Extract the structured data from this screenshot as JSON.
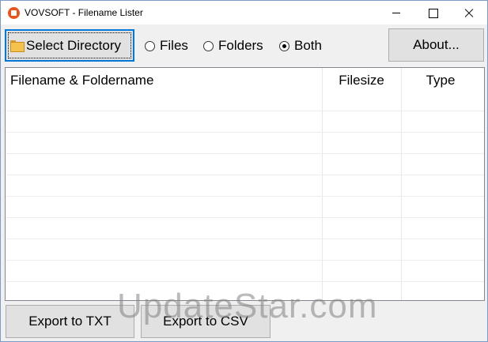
{
  "window": {
    "title": "VOVSOFT - Filename Lister"
  },
  "toolbar": {
    "select_directory_label": "Select Directory",
    "radio_files_label": "Files",
    "radio_folders_label": "Folders",
    "radio_both_label": "Both",
    "selected_mode": "Both",
    "about_label": "About..."
  },
  "list": {
    "columns": [
      "Filename & Foldername",
      "Filesize",
      "Type"
    ],
    "rows": []
  },
  "footer": {
    "export_txt_label": "Export to TXT",
    "export_csv_label": "Export to CSV"
  },
  "watermark": "UpdateStar.com",
  "colors": {
    "accent": "#0078d7",
    "app_icon": "#e8541a"
  },
  "icons": {
    "app": "app-logo-icon",
    "select_directory": "folder-icon"
  }
}
